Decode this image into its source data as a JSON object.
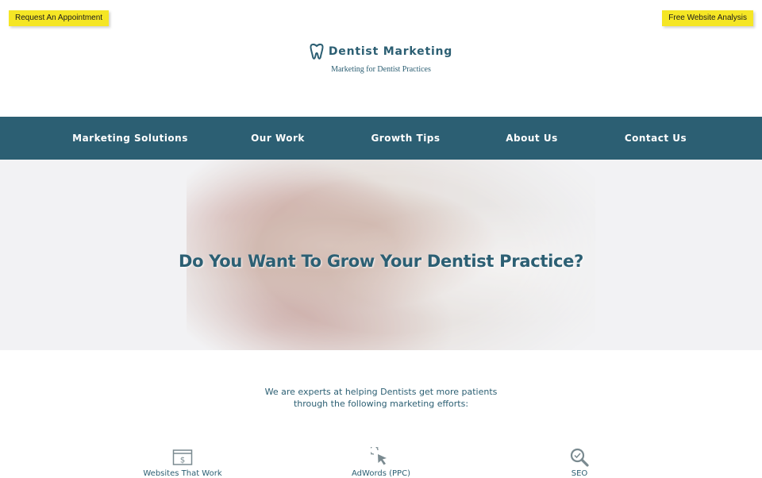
{
  "topbar": {
    "left_button": "Request An Appointment",
    "right_button": "Free Website Analysis"
  },
  "brand": {
    "name": "Dentist Marketing",
    "tagline": "Marketing for Dentist Practices",
    "icon": "tooth-icon"
  },
  "nav": {
    "items": [
      {
        "label": "Marketing Solutions"
      },
      {
        "label": "Our Work"
      },
      {
        "label": "Growth Tips"
      },
      {
        "label": "About Us"
      },
      {
        "label": "Contact Us"
      }
    ]
  },
  "hero": {
    "title": "Do You Want To Grow Your Dentist Practice?"
  },
  "intro": {
    "line1": "We are experts at helping Dentists get more patients",
    "line2": "through the following marketing efforts:"
  },
  "features": [
    {
      "label": "Websites That Work",
      "icon": "website-dollar-icon"
    },
    {
      "label": "AdWords (PPC)",
      "icon": "cursor-click-icon"
    },
    {
      "label": "SEO",
      "icon": "magnifier-icon"
    }
  ],
  "colors": {
    "primary": "#2c5f73",
    "accent": "#f5e625",
    "hero_bg": "#f2f2f4"
  }
}
